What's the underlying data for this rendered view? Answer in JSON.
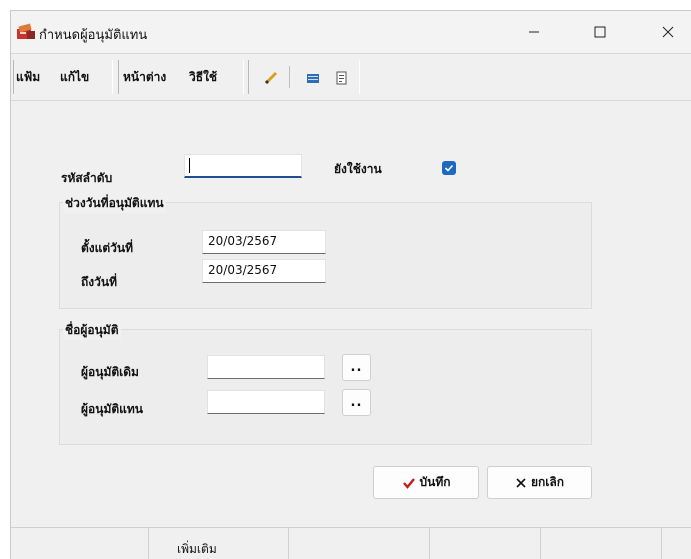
{
  "window": {
    "title": "กำหนดผู้อนุมัติแทน",
    "controls": {
      "minimize_icon": "minimize-icon",
      "maximize_icon": "maximize-icon",
      "close_icon": "close-icon"
    }
  },
  "menu": {
    "items": [
      {
        "label": "แฟ้ม"
      },
      {
        "label": "แก้ไข"
      },
      {
        "label": "หน้าต่าง"
      },
      {
        "label": "วิธีใช้"
      }
    ],
    "toolbar_icons": [
      "edit-icon",
      "table-icon",
      "document-icon"
    ]
  },
  "form": {
    "code_label": "รหัสลำดับ",
    "code_value": "",
    "active_label": "ยังใช้งาน",
    "active_checked": true,
    "date_range": {
      "title": "ช่วงวันที่อนุมัติแทน",
      "from_label": "ตั้งแต่วันที่",
      "from_value": "20/03/2567",
      "to_label": "ถึงวันที่",
      "to_value": "20/03/2567"
    },
    "approver": {
      "title": "ชื่อผู้อนุมัติ",
      "original_label": "ผู้อนุมัติเดิม",
      "original_value": "",
      "substitute_label": "ผู้อนุมัติแทน",
      "substitute_value": "",
      "browse_label": ".."
    },
    "save_label": "บันทึก",
    "cancel_label": "ยกเลิก"
  },
  "statusbar": {
    "cells": [
      "",
      "เพิ่มเติม",
      "",
      "",
      "",
      ""
    ]
  },
  "colors": {
    "accent": "#1e6ac1",
    "save_check": "#c41c1c"
  }
}
